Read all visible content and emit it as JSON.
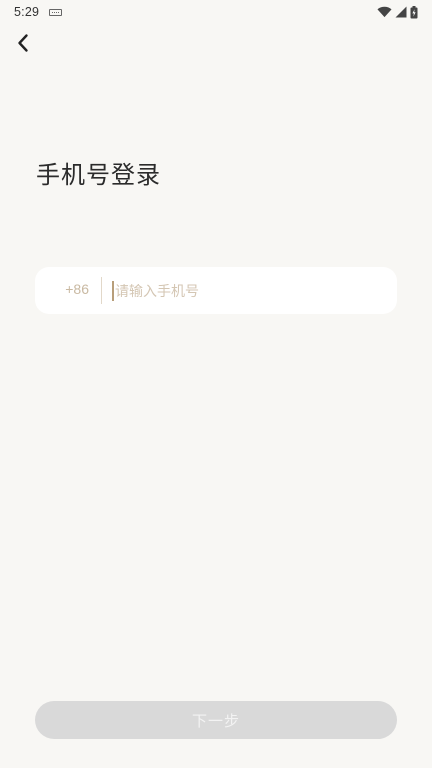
{
  "status_bar": {
    "time": "5:29",
    "icons": [
      "keyboard-icon",
      "wifi-icon",
      "signal-icon",
      "battery-icon"
    ]
  },
  "header": {
    "back_icon": "chevron-left-icon"
  },
  "page": {
    "title": "手机号登录"
  },
  "phone_field": {
    "country_code": "+86",
    "placeholder": "请输入手机号",
    "value": ""
  },
  "actions": {
    "next_label": "下一步",
    "next_enabled": false
  },
  "colors": {
    "background": "#f8f7f4",
    "accent": "#c9b9a2",
    "button_disabled": "#d9d9d9"
  }
}
